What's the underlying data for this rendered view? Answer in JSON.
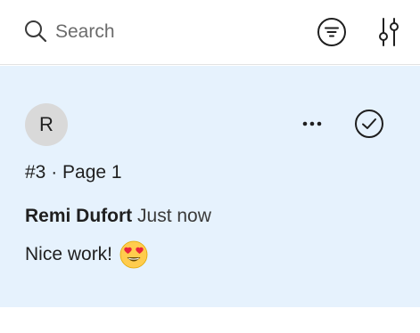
{
  "search": {
    "placeholder": "Search"
  },
  "comment": {
    "avatar_initial": "R",
    "thread_ref": "#3 · Page 1",
    "author": "Remi Dufort",
    "time": "Just now",
    "text": "Nice work!",
    "emoji": "heart-eyes-emoji"
  },
  "icons": {
    "search": "search-icon",
    "filter": "filter-icon",
    "settings": "sliders-icon",
    "more": "more-horizontal-icon",
    "resolve": "check-circle-icon"
  },
  "colors": {
    "card_background": "#e6f2fd",
    "avatar_background": "#d9d9d9",
    "icon": "#1f1f1f"
  }
}
